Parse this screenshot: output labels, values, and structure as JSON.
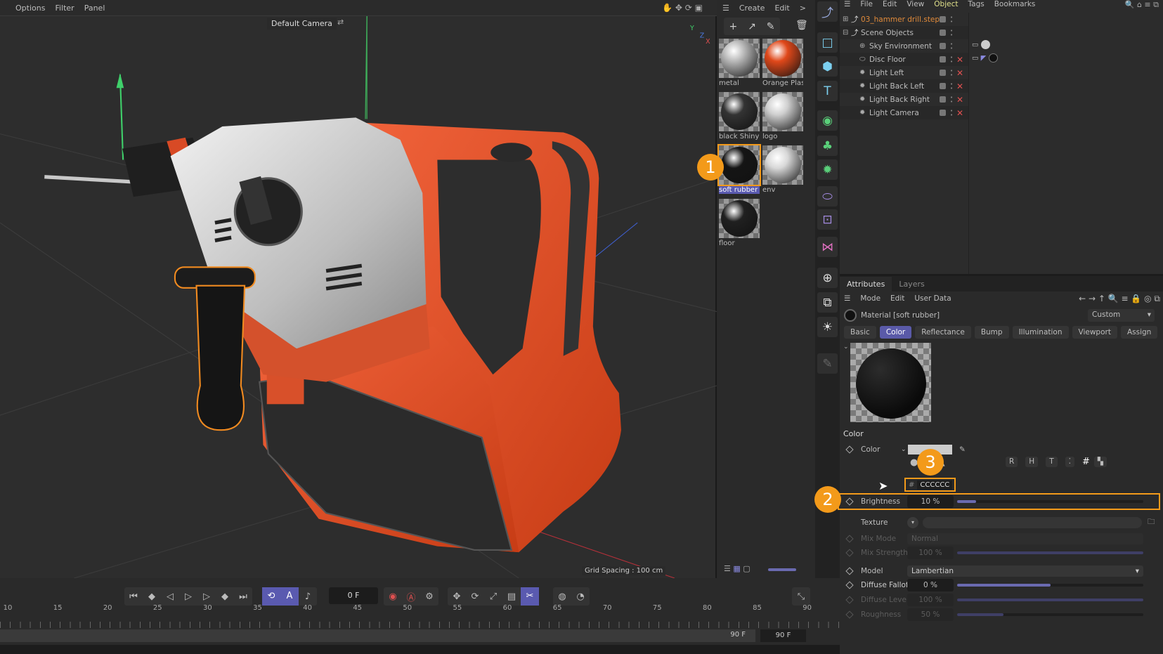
{
  "viewport": {
    "menu": [
      "Options",
      "Filter",
      "Panel"
    ],
    "camera": "Default Camera",
    "grid_spacing": "Grid Spacing : 100 cm"
  },
  "material_manager": {
    "menu": [
      "Create",
      "Edit",
      ">"
    ],
    "toolbar_icons": [
      "plus-icon",
      "arrow-icon",
      "eyedropper-icon",
      "trash-icon"
    ],
    "materials": [
      {
        "name": "metal",
        "color": "#b8b8b8"
      },
      {
        "name": "Orange Plas",
        "color": "#e0481a"
      },
      {
        "name": "black Shiny",
        "color": "#333333"
      },
      {
        "name": "logo",
        "color": "#cfcfcf"
      },
      {
        "name": "soft rubber",
        "color": "#151515",
        "selected": true
      },
      {
        "name": "env",
        "color": "#d8d8d8"
      },
      {
        "name": "floor",
        "color": "#202020"
      }
    ]
  },
  "object_manager": {
    "menu": [
      "File",
      "Edit",
      "View",
      "Object",
      "Tags",
      "Bookmarks"
    ],
    "active_menu": "Object",
    "objects": [
      {
        "name": "03_hammer drill.step",
        "level": 0,
        "color": "#e08a3a",
        "x": false
      },
      {
        "name": "Scene Objects",
        "level": 0,
        "x": false
      },
      {
        "name": "Sky Environment",
        "level": 1,
        "x": false
      },
      {
        "name": "Disc Floor",
        "level": 1,
        "x": true
      },
      {
        "name": "Light Left",
        "level": 1,
        "x": true
      },
      {
        "name": "Light Back Left",
        "level": 1,
        "x": true
      },
      {
        "name": "Light Back Right",
        "level": 1,
        "x": true
      },
      {
        "name": "Light Camera",
        "level": 1,
        "x": true
      }
    ]
  },
  "attributes": {
    "tabs": [
      "Attributes",
      "Layers"
    ],
    "menu": [
      "Mode",
      "Edit",
      "User Data"
    ],
    "material_title": "Material [soft rubber]",
    "preset": "Custom",
    "sub_tabs": [
      "Basic",
      "Color",
      "Reflectance",
      "Bump",
      "Illumination",
      "Viewport",
      "Assign"
    ],
    "active_sub_tab": "Color",
    "section": "Color",
    "color_label": "Color",
    "color_value": "#CCCCCC",
    "hex_prefix": "#",
    "hex": "CCCCCC",
    "mode_buttons": [
      "R",
      "H",
      "T",
      "#"
    ],
    "brightness": {
      "label": "Brightness",
      "value": "10 %",
      "fraction": 0.1
    },
    "texture": {
      "label": "Texture"
    },
    "mix_mode": {
      "label": "Mix Mode",
      "value": "Normal"
    },
    "mix_strength": {
      "label": "Mix Strength",
      "value": "100 %",
      "fraction": 1.0
    },
    "model": {
      "label": "Model",
      "value": "Lambertian"
    },
    "diffuse_falloff": {
      "label": "Diffuse Falloff",
      "value": "0 %",
      "fraction": 0.5
    },
    "diffuse_level": {
      "label": "Diffuse Level",
      "value": "100 %",
      "fraction": 1.0
    },
    "roughness": {
      "label": "Roughness",
      "value": "50 %",
      "fraction": 0.25
    }
  },
  "timeline": {
    "current_frame": "0 F",
    "ruler": [
      "10",
      "15",
      "20",
      "25",
      "30",
      "35",
      "40",
      "45",
      "50",
      "55",
      "60",
      "65",
      "70",
      "75",
      "80",
      "85",
      "90"
    ],
    "end_frame": "90 F",
    "max_frame": "90 F"
  },
  "annotations": [
    "1",
    "2",
    "3"
  ],
  "colors": {
    "accent": "#5a5ab0",
    "highlight": "#f39a1a",
    "orange_plastic": "#e0481a"
  }
}
